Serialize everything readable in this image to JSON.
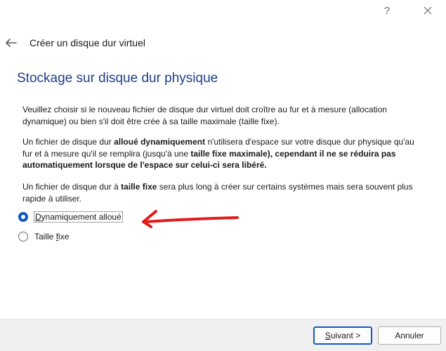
{
  "titlebar": {
    "help_label": "?",
    "close_icon": "close-icon"
  },
  "nav": {
    "back_icon": "back-arrow-icon",
    "title": "Créer un disque dur virtuel"
  },
  "section_title": "Stockage sur disque dur physique",
  "paragraph1": "Veuillez choisir si le nouveau fichier de disque dur virtuel doit croître au fur et à mesure (allocation dynamique) ou bien s'il doit être crée à sa taille maximale (taille fixe).",
  "paragraph2": {
    "part1": "Un fichier de disque dur ",
    "bold1": "alloué dynamiquement",
    "part2": " n'utilisera d'espace sur votre disque dur physique qu'au fur et à mesure qu'il se remplira (jusqu'à une ",
    "bold2": "taille fixe maximale), cependant il ne se réduira pas automatiquement lorsque de l'espace sur celui-ci sera libéré."
  },
  "paragraph3": {
    "part1": "Un fichier de disque dur à ",
    "bold1": "taille fixe",
    "part2": " sera plus long à créer sur certains systèmes mais sera souvent plus rapide à utiliser."
  },
  "options": [
    {
      "label_pre": "",
      "label_u": "D",
      "label_post": "ynamiquement alloué",
      "selected": true
    },
    {
      "label_pre": "Taille ",
      "label_u": "f",
      "label_post": "ixe",
      "selected": false
    }
  ],
  "buttons": {
    "next_u": "S",
    "next_rest": "uivant >",
    "cancel": "Annuler"
  },
  "annotation_color": "#e11b1b",
  "accent_color": "#1058c0"
}
